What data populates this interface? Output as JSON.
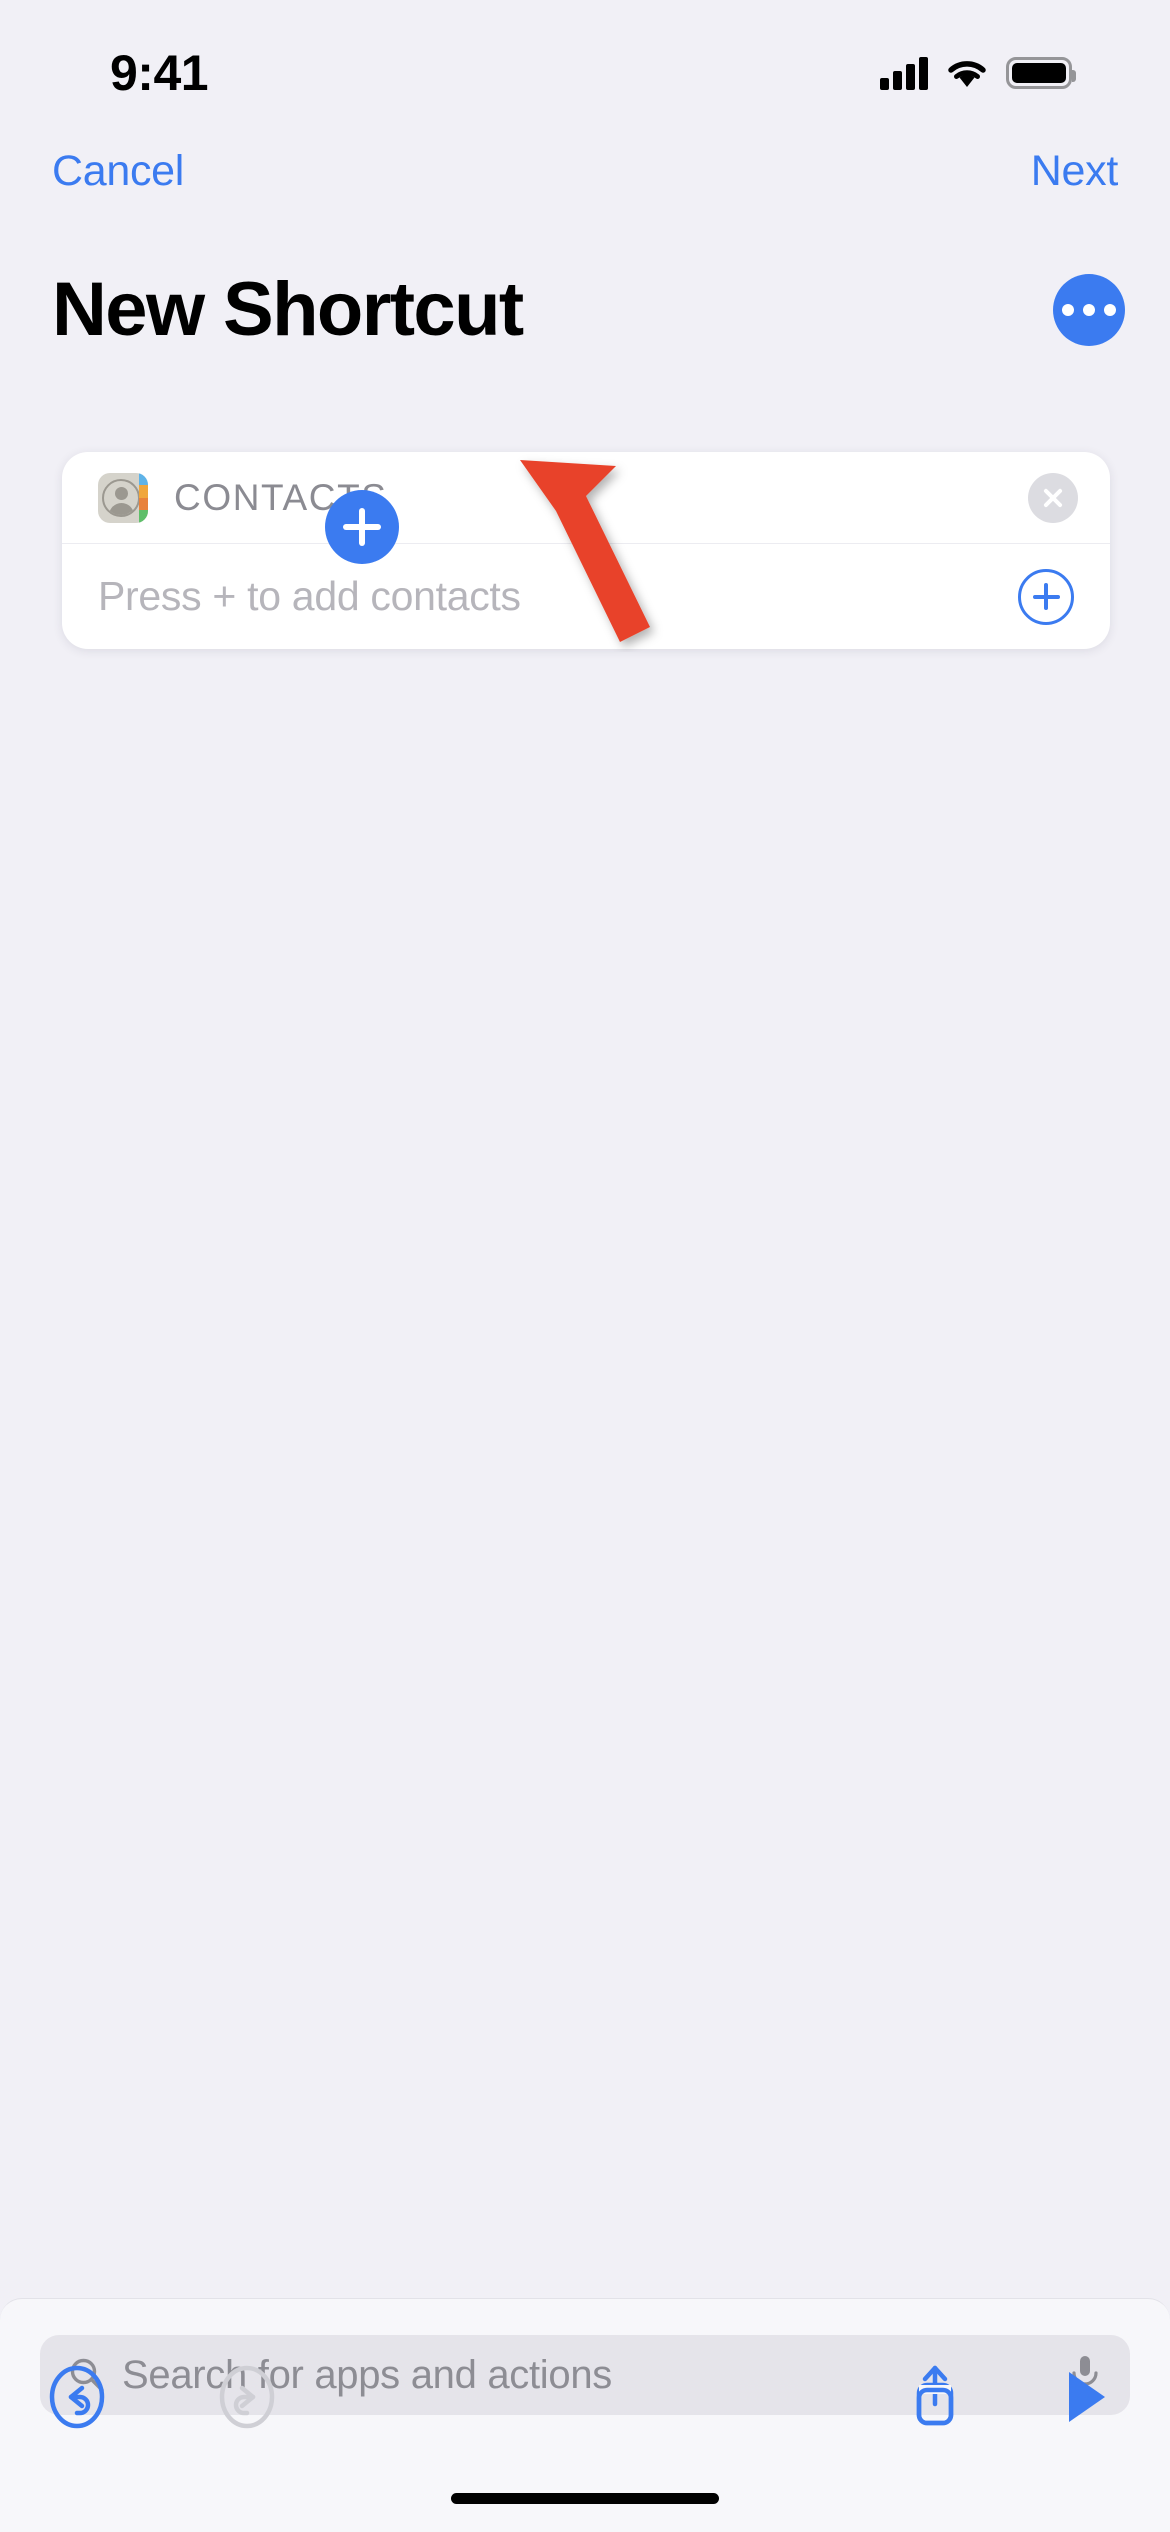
{
  "status_bar": {
    "time": "9:41",
    "cellular_icon": "cellular-signal-icon",
    "wifi_icon": "wifi-icon",
    "battery_icon": "battery-full-icon"
  },
  "nav": {
    "cancel_label": "Cancel",
    "next_label": "Next"
  },
  "header": {
    "title": "New Shortcut",
    "more_button_icon": "ellipsis-icon"
  },
  "action_card": {
    "app_icon": "contacts-app-icon",
    "title": "CONTACTS",
    "close_icon": "close-circle-icon",
    "parameter_placeholder": "Press + to add contacts",
    "add_icon": "plus-circle-icon"
  },
  "add_action_button": {
    "icon": "plus-icon"
  },
  "annotation": {
    "arrow_icon": "red-arrow-up-left-icon",
    "color": "#e8432a"
  },
  "search": {
    "placeholder": "Search for apps and actions",
    "search_icon": "search-icon",
    "mic_icon": "microphone-icon"
  },
  "toolbar": {
    "undo_icon": "undo-icon",
    "redo_icon": "redo-icon",
    "share_icon": "share-icon",
    "run_icon": "play-icon"
  },
  "colors": {
    "accent_blue": "#3b7bf0",
    "background": "#f1f0f6",
    "card_background": "#ffffff",
    "disabled_gray": "#c9c9cf",
    "annotation_red": "#e8432a"
  },
  "home_indicator": "home-indicator"
}
